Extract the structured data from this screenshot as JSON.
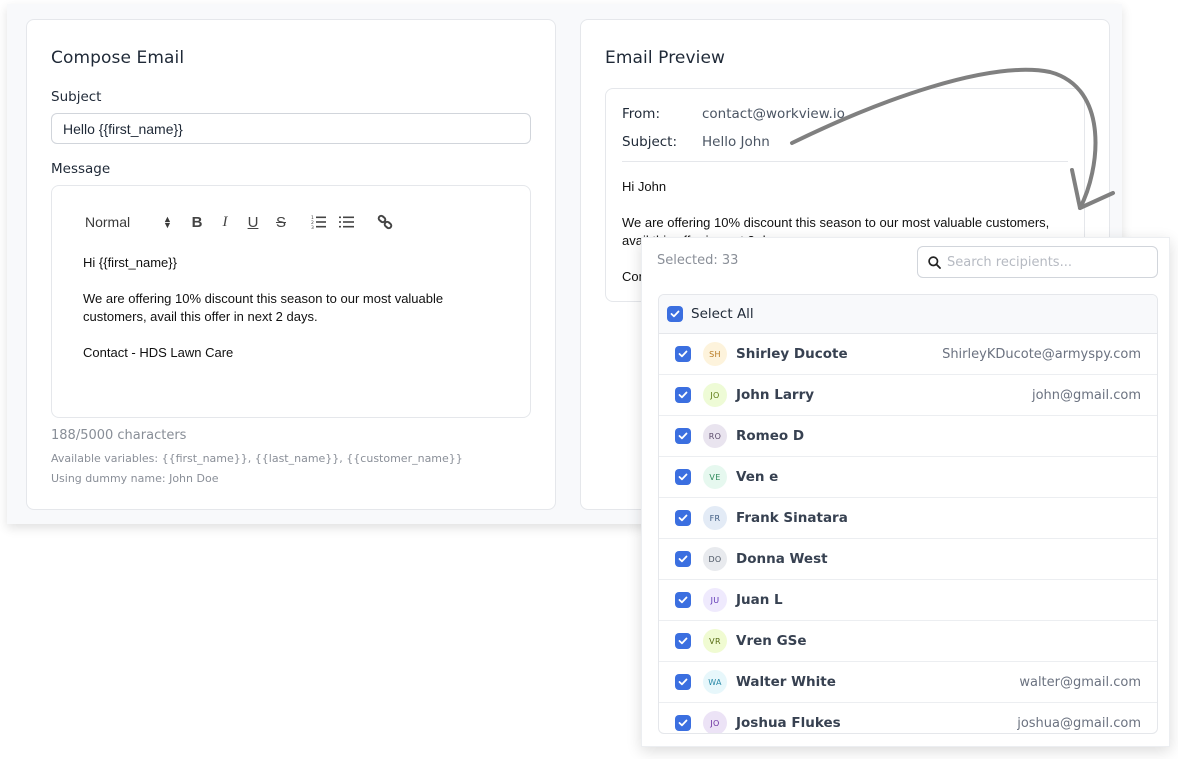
{
  "compose": {
    "title": "Compose Email",
    "subject_label": "Subject",
    "subject_value": "Hello {{first_name}}",
    "message_label": "Message",
    "toolbar": {
      "heading_select": "Normal",
      "bold": "B",
      "italic": "I",
      "underline": "U",
      "strike": "S",
      "ordered_list_icon": "ordered-list-icon",
      "bullet_list_icon": "bullet-list-icon",
      "link_icon": "link-icon"
    },
    "body": [
      "Hi {{first_name}}",
      "We are offering 10% discount this season to our most valuable customers, avail this offer in next 2 days.",
      "Contact - HDS Lawn Care"
    ],
    "char_count": "188/5000 characters",
    "variables_hint": "Available variables: {{first_name}}, {{last_name}}, {{customer_name}}",
    "dummy_hint": "Using dummy name: John Doe"
  },
  "preview": {
    "title": "Email Preview",
    "from_label": "From:",
    "from_value": "contact@workview.io",
    "subject_label": "Subject:",
    "subject_value": "Hello John",
    "body": [
      "Hi John",
      "We are offering 10% discount this season to our most valuable customers, avail this offer in next 2 days.",
      "Contact - HDS Lawn Care"
    ]
  },
  "recipients": {
    "selected_count": "Selected: 33",
    "search_placeholder": "Search recipients...",
    "select_all_label": "Select All",
    "select_all_checked": true,
    "accent_color": "#3b6fe0",
    "items": [
      {
        "initials": "SH",
        "name": "Shirley Ducote",
        "email": "ShirleyKDucote@armyspy.com",
        "checked": true,
        "bg": "#fdf3dc",
        "fg": "#b7791f"
      },
      {
        "initials": "JO",
        "name": "John Larry",
        "email": "john@gmail.com",
        "checked": true,
        "bg": "#eefbd6",
        "fg": "#5b7a12"
      },
      {
        "initials": "RO",
        "name": "Romeo D",
        "email": "",
        "checked": true,
        "bg": "#e9e4ef",
        "fg": "#5b4a6b"
      },
      {
        "initials": "VE",
        "name": "Ven e",
        "email": "",
        "checked": true,
        "bg": "#e6f8ef",
        "fg": "#2f8a5b"
      },
      {
        "initials": "FR",
        "name": "Frank Sinatara",
        "email": "",
        "checked": true,
        "bg": "#e3ebf6",
        "fg": "#3d5a80"
      },
      {
        "initials": "DO",
        "name": "Donna West",
        "email": "",
        "checked": true,
        "bg": "#e8eaee",
        "fg": "#4b5563"
      },
      {
        "initials": "JU",
        "name": "Juan L",
        "email": "",
        "checked": true,
        "bg": "#efeafd",
        "fg": "#5b32b4"
      },
      {
        "initials": "VR",
        "name": "Vren GSe",
        "email": "",
        "checked": true,
        "bg": "#f0fbd2",
        "fg": "#556b12"
      },
      {
        "initials": "WA",
        "name": "Walter White",
        "email": "walter@gmail.com",
        "checked": true,
        "bg": "#e7f7fb",
        "fg": "#2a8aa8"
      },
      {
        "initials": "JO",
        "name": "Joshua Flukes",
        "email": "joshua@gmail.com",
        "checked": true,
        "bg": "#ece3f6",
        "fg": "#6b2fa0"
      }
    ]
  }
}
